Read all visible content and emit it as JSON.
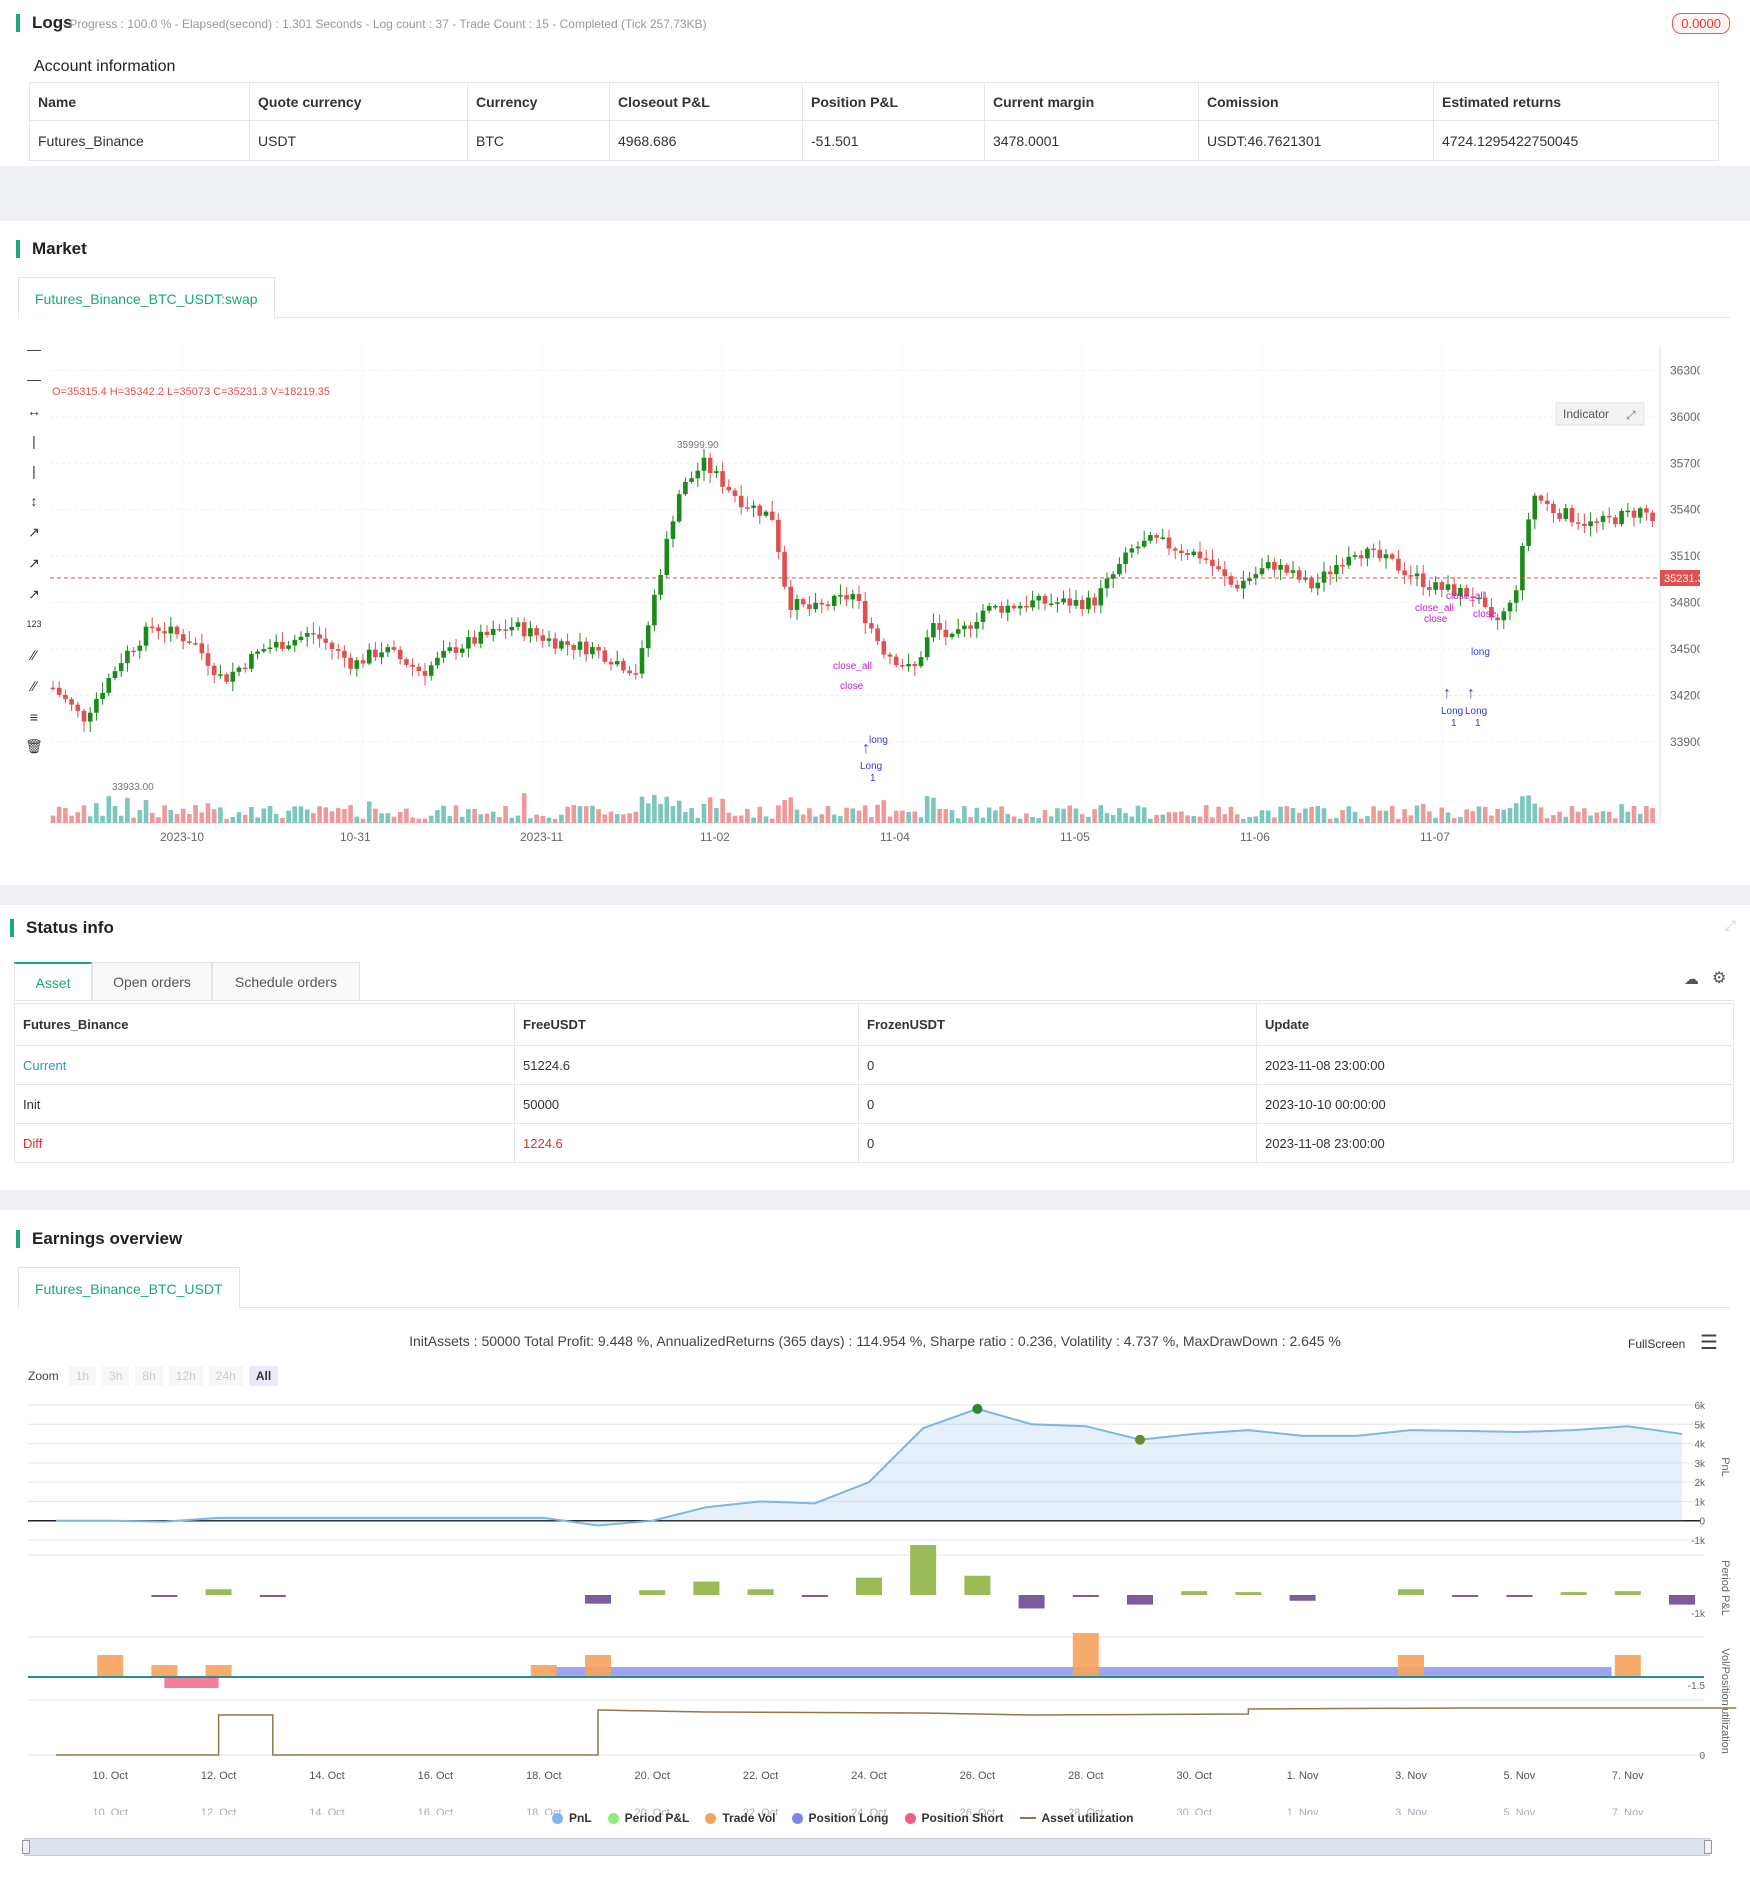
{
  "logs": {
    "title": "Logs",
    "meta": "- Progress : 100.0 % - Elapsed(second) : 1.301  Seconds - Log count : 37 - Trade Count : 15 - Completed (Tick 257.73KB)",
    "badge": "0.0000"
  },
  "account": {
    "title": "Account information",
    "headers": [
      "Name",
      "Quote currency",
      "Currency",
      "Closeout P&L",
      "Position P&L",
      "Current margin",
      "Comission",
      "Estimated returns"
    ],
    "row": [
      "Futures_Binance",
      "USDT",
      "BTC",
      "4968.686",
      "-51.501",
      "3478.0001",
      "USDT:46.7621301",
      "4724.1295422750045"
    ]
  },
  "market": {
    "title": "Market",
    "tab": "Futures_Binance_BTC_USDT:swap",
    "ohlc": "O=35315.4  H=35342.2  L=35073  C=35231.3  V=18219.35",
    "indicator_button": "Indicator",
    "current_price": "35231.30",
    "high_label": "35999.90",
    "low_label": "33933.00",
    "price_ticks": [
      "36300.00",
      "36000.00",
      "35700.00",
      "35400.00",
      "35100.00",
      "34800.00",
      "34500.00",
      "34200.00",
      "33900.00"
    ],
    "time_ticks": [
      "2023-10",
      "10-31",
      "2023-11",
      "11-02",
      "11-04",
      "11-05",
      "11-06",
      "11-07"
    ],
    "markers": {
      "close_all": "close_all",
      "close": "close",
      "long": "Long",
      "one": "1",
      "lower_long": "long"
    },
    "colors": {
      "up": "#1a8a1a",
      "down": "#e05050",
      "vol_up": "#7cc7bd",
      "vol_down": "#ef9a9a"
    }
  },
  "status": {
    "title": "Status info",
    "tabs": [
      "Asset",
      "Open orders",
      "Schedule orders"
    ],
    "headers": [
      "Futures_Binance",
      "FreeUSDT",
      "FrozenUSDT",
      "Update"
    ],
    "rows": [
      [
        "Current",
        "51224.6",
        "0",
        "2023-11-08 23:00:00"
      ],
      [
        "Init",
        "50000",
        "0",
        "2023-10-10 00:00:00"
      ],
      [
        "Diff",
        "1224.6",
        "0",
        "2023-11-08 23:00:00"
      ]
    ]
  },
  "earnings": {
    "title": "Earnings overview",
    "tab": "Futures_Binance_BTC_USDT",
    "summary": "InitAssets : 50000 Total Profit: 9.448 %, AnnualizedReturns (365 days) : 114.954 %, Sharpe ratio : 0.236, Volatility : 4.737 %, MaxDrawDown : 2.645 %",
    "fullscreen": "FullScreen",
    "zoom_label": "Zoom",
    "zoom_options": [
      "1h",
      "3h",
      "8h",
      "12h",
      "24h",
      "All"
    ],
    "pnl_ticks": [
      "6k",
      "5k",
      "4k",
      "3k",
      "2k",
      "1k",
      "0",
      "-1k"
    ],
    "period_tick": "-1k",
    "vol_tick": "-1.5",
    "util_tick": "0",
    "axis_titles": [
      "PnL",
      "Period P&L",
      "Vol/Position",
      "utilization"
    ],
    "x_ticks": [
      "10. Oct",
      "12. Oct",
      "14. Oct",
      "16. Oct",
      "18. Oct",
      "20. Oct",
      "22. Oct",
      "24. Oct",
      "26. Oct",
      "28. Oct",
      "30. Oct",
      "1. Nov",
      "3. Nov",
      "5. Nov",
      "7. Nov"
    ],
    "legend": [
      {
        "name": "PnL",
        "color": "#7cb5ec"
      },
      {
        "name": "Period P&L",
        "color": "#90ed7d"
      },
      {
        "name": "Trade Vol",
        "color": "#f7a35c"
      },
      {
        "name": "Position Long",
        "color": "#8085e9"
      },
      {
        "name": "Position Short",
        "color": "#f15c80"
      },
      {
        "name": "Asset utilization",
        "color": "#8d7a4a"
      }
    ]
  },
  "chart_data": {
    "type": "line",
    "title": "",
    "x": [
      "9. Oct",
      "10. Oct",
      "11. Oct",
      "12. Oct",
      "13. Oct",
      "14. Oct",
      "15. Oct",
      "16. Oct",
      "17. Oct",
      "18. Oct",
      "19. Oct",
      "20. Oct",
      "21. Oct",
      "22. Oct",
      "23. Oct",
      "24. Oct",
      "25. Oct",
      "26. Oct",
      "27. Oct",
      "28. Oct",
      "29. Oct",
      "30. Oct",
      "31. Oct",
      "1. Nov",
      "2. Nov",
      "3. Nov",
      "4. Nov",
      "5. Nov",
      "6. Nov",
      "7. Nov",
      "8. Nov"
    ],
    "series": [
      {
        "name": "PnL",
        "values": [
          0,
          0,
          -50,
          150,
          150,
          150,
          150,
          150,
          150,
          150,
          -250,
          0,
          700,
          1000,
          900,
          2000,
          4800,
          5800,
          5000,
          4900,
          4200,
          4500,
          4700,
          4400,
          4400,
          4700,
          4650,
          4600,
          4700,
          4900,
          4500
        ]
      },
      {
        "name": "Period P&L",
        "values": [
          0,
          0,
          -100,
          300,
          -50,
          0,
          0,
          0,
          0,
          0,
          -450,
          250,
          700,
          300,
          -100,
          900,
          2600,
          1000,
          -700,
          -50,
          -500,
          200,
          150,
          -300,
          0,
          300,
          -50,
          -50,
          150,
          200,
          -500
        ]
      }
    ],
    "ylim": [
      -1000,
      6000
    ]
  }
}
